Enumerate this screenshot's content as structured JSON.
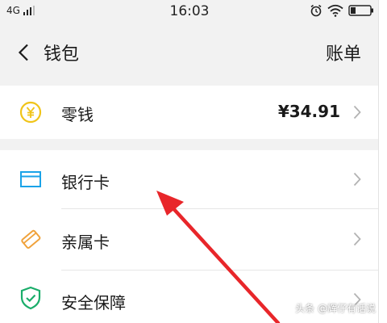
{
  "status_bar": {
    "network": "4G",
    "time": "16:03"
  },
  "header": {
    "title": "钱包",
    "action": "账单"
  },
  "rows": [
    {
      "label": "零钱",
      "value": "¥34.91",
      "icon": "yuan-coin-icon"
    },
    {
      "label": "银行卡",
      "icon": "bank-card-icon"
    },
    {
      "label": "亲属卡",
      "icon": "family-card-icon"
    },
    {
      "label": "安全保障",
      "icon": "shield-check-icon"
    }
  ],
  "watermark": "头条 @辉仔有话说",
  "colors": {
    "background": "#f2f2f2",
    "coin": "#f0c419",
    "bank_card": "#1aa3e8",
    "family_card": "#f0a23b",
    "shield": "#1aad6a",
    "annotation_arrow": "#e8262a"
  }
}
